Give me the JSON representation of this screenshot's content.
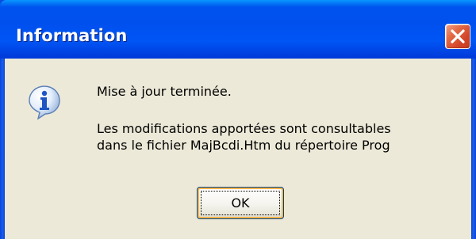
{
  "dialog": {
    "title": "Information",
    "icon": "info-icon",
    "message_line1": "Mise à jour terminée.",
    "message_line2": "Les modifications apportées sont consultables",
    "message_line3": "dans le fichier MajBcdi.Htm du répertoire Prog",
    "ok_label": "OK"
  },
  "titlebar": {
    "close_icon": "close-icon"
  },
  "colors": {
    "titlebar_blue": "#0053ee",
    "client_background": "#ece9d8",
    "close_button_red": "#e36a45",
    "button_focus_orange": "#f3ad3f"
  }
}
